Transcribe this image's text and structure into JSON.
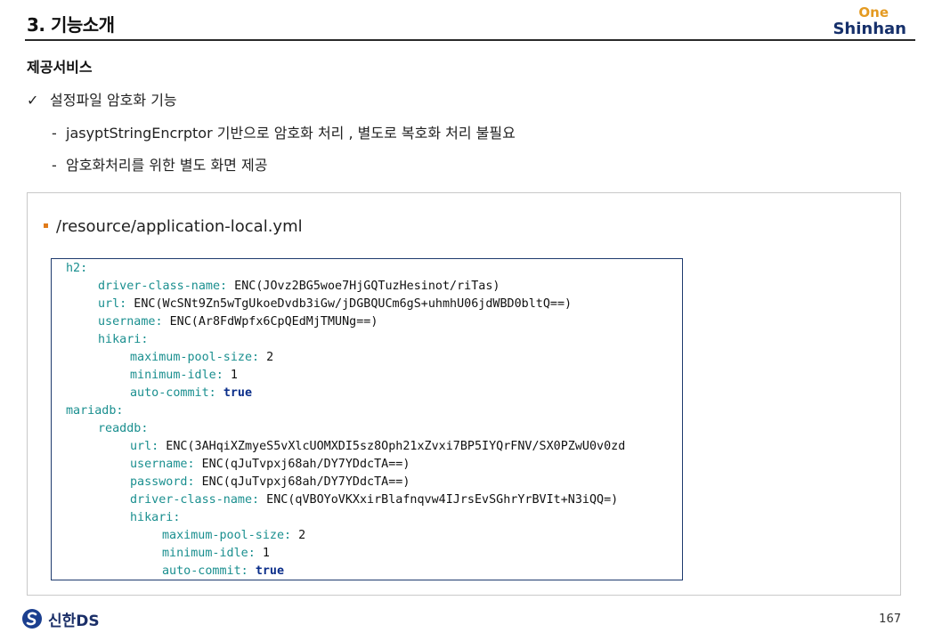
{
  "header": {
    "title": "3. 기능소개",
    "logo_one": "One",
    "logo_shinhan": "Shinhan"
  },
  "section": {
    "title": "제공서비스",
    "check_mark": "✓",
    "check_item": "설정파일 암호화 기능",
    "dash": "-",
    "sub_items": [
      "jasyptStringEncrptor 기반으로 암호화 처리 , 별도로 복호화 처리 불필요",
      "암호화처리를 위한 별도 화면 제공"
    ]
  },
  "content": {
    "file_path": "/resource/application-local.yml",
    "code_lines": [
      {
        "key": "h2:",
        "value": "",
        "kw": ""
      },
      {
        "key": "driver-class-name:",
        "value": " ENC(JOvz2BG5woe7HjGQTuzHesinot/riTas)",
        "kw": ""
      },
      {
        "key": "url:",
        "value": " ENC(WcSNt9Zn5wTgUkoeDvdb3iGw/jDGBQUCm6gS+uhmhU06jdWBD0bltQ==)",
        "kw": ""
      },
      {
        "key": "username:",
        "value": " ENC(Ar8FdWpfx6CpQEdMjTMUNg==)",
        "kw": ""
      },
      {
        "key": "hikari:",
        "value": "",
        "kw": ""
      },
      {
        "key": "maximum-pool-size:",
        "value": " 2",
        "kw": ""
      },
      {
        "key": "minimum-idle:",
        "value": " 1",
        "kw": ""
      },
      {
        "key": "auto-commit:",
        "value": " ",
        "kw": "true"
      },
      {
        "key": "mariadb:",
        "value": "",
        "kw": ""
      },
      {
        "key": "readdb:",
        "value": "",
        "kw": ""
      },
      {
        "key": "url:",
        "value": " ENC(3AHqiXZmyeS5vXlcUOMXDI5sz8Oph21xZvxi7BP5IYQrFNV/SX0PZwU0v0zd",
        "kw": ""
      },
      {
        "key": "username:",
        "value": " ENC(qJuTvpxj68ah/DY7YDdcTA==)",
        "kw": ""
      },
      {
        "key": "password:",
        "value": " ENC(qJuTvpxj68ah/DY7YDdcTA==)",
        "kw": ""
      },
      {
        "key": "driver-class-name:",
        "value": " ENC(qVBOYoVKXxirBlafnqvw4IJrsEvSGhrYrBVIt+N3iQQ=)",
        "kw": ""
      },
      {
        "key": "hikari:",
        "value": "",
        "kw": ""
      },
      {
        "key": "maximum-pool-size:",
        "value": " 2",
        "kw": ""
      },
      {
        "key": "minimum-idle:",
        "value": " 1",
        "kw": ""
      },
      {
        "key": "auto-commit:",
        "value": " ",
        "kw": "true"
      }
    ]
  },
  "footer": {
    "logo_text": "신한DS",
    "page_number": "167"
  }
}
